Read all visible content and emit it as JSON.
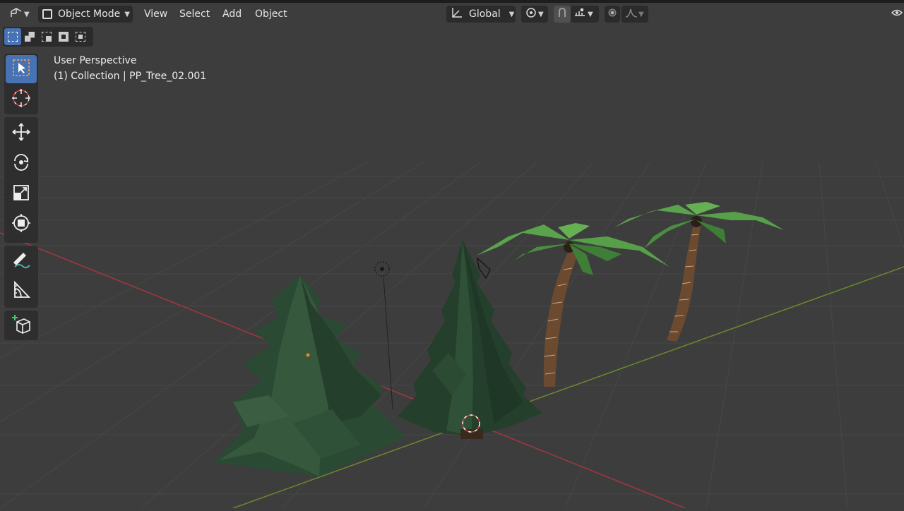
{
  "header": {
    "mode_label": "Object Mode",
    "menus": [
      "View",
      "Select",
      "Add",
      "Object"
    ],
    "orientation_label": "Global"
  },
  "viewport": {
    "perspective_label": "User Perspective",
    "collection_label": "(1) Collection | PP_Tree_02.001"
  },
  "colors": {
    "background": "#3d3d3d",
    "accent": "#4772b3",
    "x_axis": "#a6363f",
    "y_axis": "#6b8a2a",
    "tree_green": "#2b4a33",
    "palm_leaf": "#4f9a45",
    "palm_trunk": "#6b4a30"
  },
  "icons": [
    "editor-type-icon",
    "object-mode-icon",
    "transform-orientation-icon",
    "pivot-icon",
    "snap-icon",
    "snap-increment-icon",
    "proportional-edit-icon",
    "falloff-icon",
    "visibility-icon",
    "select-box-icon",
    "cursor-icon",
    "move-icon",
    "rotate-icon",
    "scale-icon",
    "transform-icon",
    "annotate-icon",
    "measure-icon",
    "add-cube-icon"
  ]
}
